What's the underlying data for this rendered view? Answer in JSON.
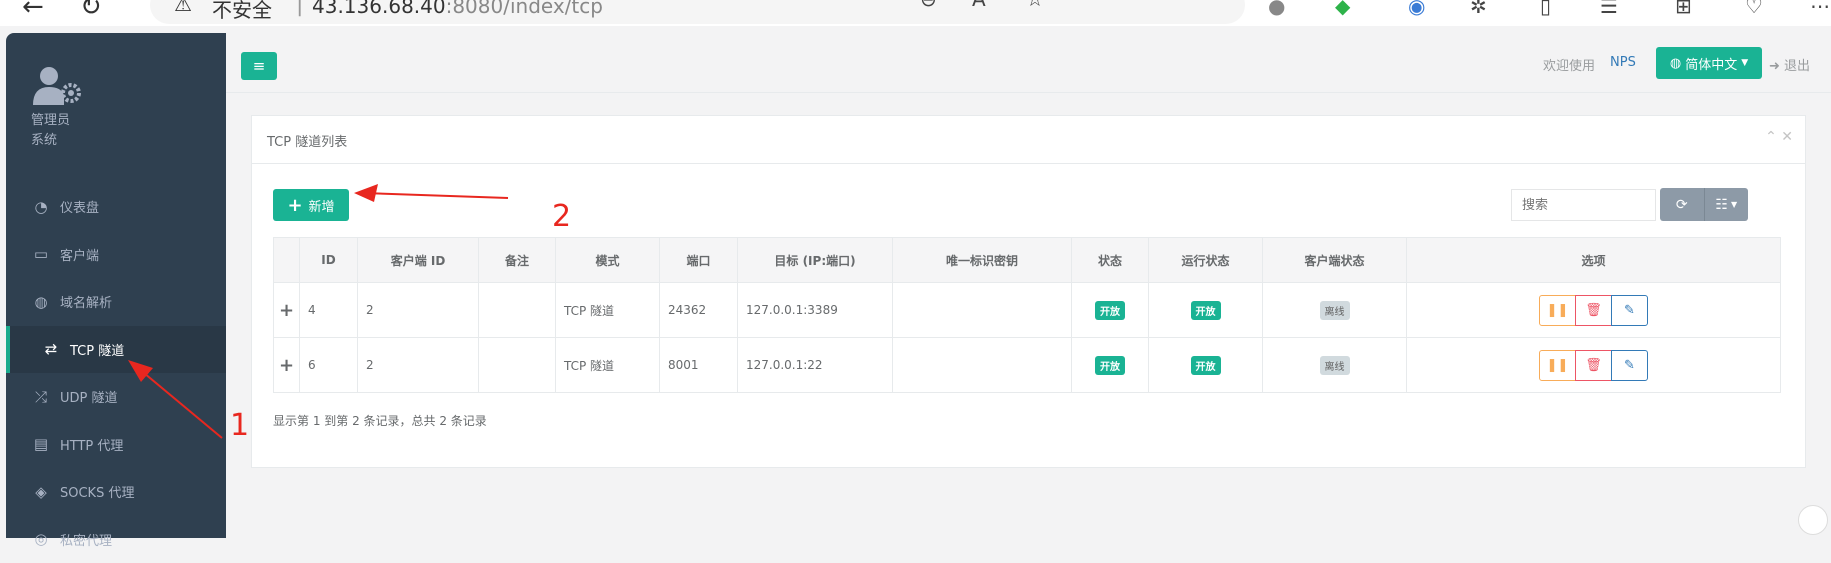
{
  "browser": {
    "insecure_label": "不安全",
    "url_host": "43.136.68.40",
    "url_port": ":8080",
    "url_path": "/index/tcp"
  },
  "sidebar": {
    "role": "管理员",
    "system": "系统",
    "items": [
      {
        "label": "仪表盘",
        "icon": "dashboard-icon"
      },
      {
        "label": "客户端",
        "icon": "desktop-icon"
      },
      {
        "label": "域名解析",
        "icon": "globe-icon"
      },
      {
        "label": "TCP 隧道",
        "icon": "retweet-icon",
        "active": true
      },
      {
        "label": "UDP 隧道",
        "icon": "random-icon"
      },
      {
        "label": "HTTP 代理",
        "icon": "server-icon"
      },
      {
        "label": "SOCKS 代理",
        "icon": "stack-icon"
      },
      {
        "label": "私密代理",
        "icon": "eye-icon"
      }
    ]
  },
  "topnav": {
    "welcome": "欢迎使用",
    "user": "NPS",
    "lang": "简体中文",
    "logout": "退出"
  },
  "panel": {
    "title": "TCP 隧道列表",
    "add_label": "新增",
    "search_placeholder": "搜索",
    "columns": [
      "ID",
      "客户端 ID",
      "备注",
      "模式",
      "端口",
      "目标 (IP:端口)",
      "唯一标识密钥",
      "状态",
      "运行状态",
      "客户端状态",
      "选项"
    ],
    "rows": [
      {
        "id": "4",
        "client_id": "2",
        "remark": "",
        "mode": "TCP 隧道",
        "port": "24362",
        "target": "127.0.0.1:3389",
        "key": "",
        "status": "开放",
        "run_status": "开放",
        "client_status": "离线"
      },
      {
        "id": "6",
        "client_id": "2",
        "remark": "",
        "mode": "TCP 隧道",
        "port": "8001",
        "target": "127.0.0.1:22",
        "key": "",
        "status": "开放",
        "run_status": "开放",
        "client_status": "离线"
      }
    ],
    "footer": "显示第 1 到第 2 条记录，总共 2 条记录"
  },
  "annotations": {
    "one": "1",
    "two": "2"
  },
  "colors": {
    "accent": "#1ab394",
    "sidebar": "#2f4050",
    "annotation": "#e8271f"
  }
}
